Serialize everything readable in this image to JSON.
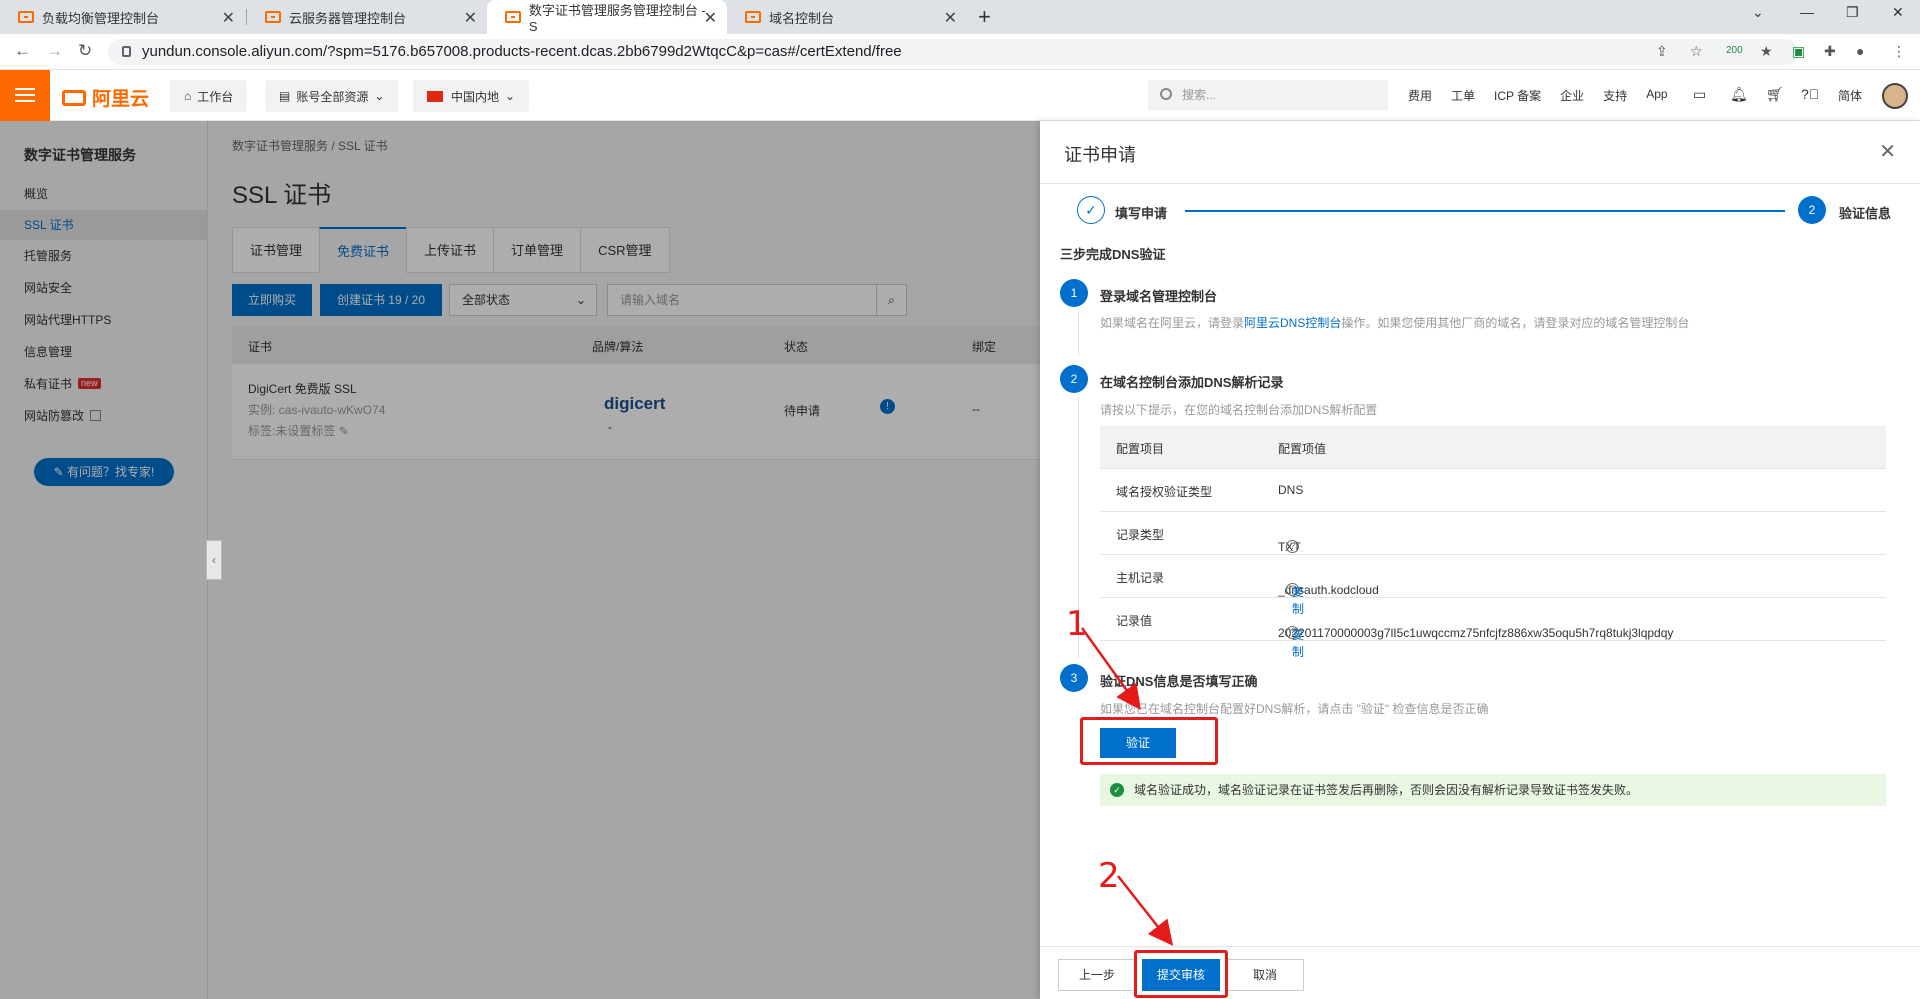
{
  "browser": {
    "tabs": [
      {
        "title": "负载均衡管理控制台"
      },
      {
        "title": "云服务器管理控制台"
      },
      {
        "title": "数字证书管理服务管理控制台 - S"
      },
      {
        "title": "域名控制台"
      }
    ],
    "url": "yundun.console.aliyun.com/?spm=5176.b657008.products-recent.dcas.2bb6799d2WtqcC&p=cas#/certExtend/free",
    "ext_badge": "200"
  },
  "header": {
    "logo": "阿里云",
    "workbench": "工作台",
    "resources": "账号全部资源",
    "region": "中国内地",
    "search_placeholder": "搜索...",
    "links": [
      "费用",
      "工单",
      "ICP 备案",
      "企业",
      "支持",
      "App"
    ],
    "lang": "简体"
  },
  "sidebar": {
    "title": "数字证书管理服务",
    "items": [
      {
        "label": "概览"
      },
      {
        "label": "SSL 证书"
      },
      {
        "label": "托管服务"
      },
      {
        "label": "网站安全"
      },
      {
        "label": "网站代理HTTPS"
      },
      {
        "label": "信息管理"
      },
      {
        "label": "私有证书"
      },
      {
        "label": "网站防篡改"
      }
    ],
    "new_badge": "new",
    "help": "有问题？找专家!"
  },
  "main": {
    "breadcrumb": "数字证书管理服务  /  SSL 证书",
    "title": "SSL 证书",
    "tabs": [
      "证书管理",
      "免费证书",
      "上传证书",
      "订单管理",
      "CSR管理"
    ],
    "buy_btn": "立即购买",
    "create_btn": "创建证书 19 / 20",
    "status_select": "全部状态",
    "domain_placeholder": "请输入域名",
    "columns": [
      "证书",
      "品牌/算法",
      "状态",
      "绑定"
    ],
    "row": {
      "name": "DigiCert 免费版 SSL",
      "instance": "实例: cas-ivauto-wKwO74",
      "tag": "标签:未设置标签",
      "brand": "digicert",
      "brand_dash": "-",
      "status": "待申请",
      "bind": "--"
    }
  },
  "drawer": {
    "title": "证书申请",
    "step1": "填写申请",
    "step2_num": "2",
    "step2": "验证信息",
    "heading": "三步完成DNS验证",
    "s1_num": "1",
    "s1_title": "登录域名管理控制台",
    "s1_desc_a": "如果域名在阿里云，请登录",
    "s1_link": "阿里云DNS控制台",
    "s1_desc_b": "操作。如果您使用其他厂商的域名，请登录对应的域名管理控制台",
    "s2_num": "2",
    "s2_title": "在域名控制台添加DNS解析记录",
    "s2_desc": "请按以下提示，在您的域名控制台添加DNS解析配置",
    "cfg_head_item": "配置项目",
    "cfg_head_value": "配置项值",
    "cfg": [
      {
        "item": "域名授权验证类型",
        "value": "DNS"
      },
      {
        "item": "记录类型",
        "value": "TXT"
      },
      {
        "item": "主机记录",
        "value": "_dnsauth.kodcloud"
      },
      {
        "item": "记录值",
        "value": "202201170000003g7lI5c1uwqccmz75nfcjfz886xw35oqu5h7rq8tukj3lqpdqy"
      }
    ],
    "copy": "复制",
    "s3_num": "3",
    "s3_title": "验证DNS信息是否填写正确",
    "s3_desc": "如果您已在域名控制台配置好DNS解析，请点击 \"验证\" 检查信息是否正确",
    "verify_btn": "验证",
    "success_msg": "域名验证成功，域名验证记录在证书签发后再删除，否则会因没有解析记录导致证书签发失败。",
    "prev_btn": "上一步",
    "submit_btn": "提交审核",
    "cancel_btn": "取消"
  },
  "annotations": [
    "1",
    "2"
  ]
}
